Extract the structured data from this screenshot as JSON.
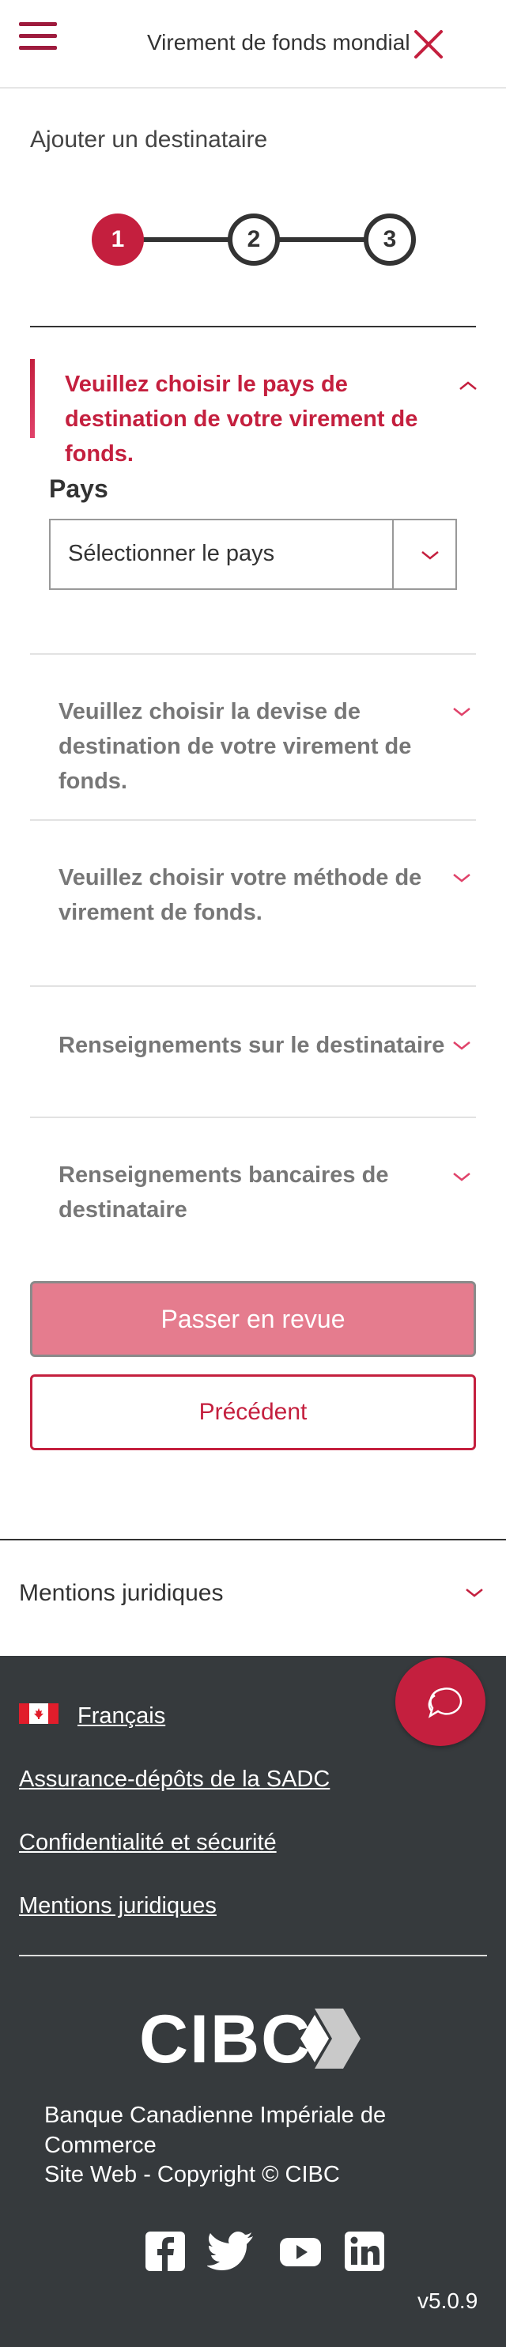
{
  "header": {
    "title": "Virement de fonds mondial"
  },
  "page": {
    "subtitle": "Ajouter un destinataire"
  },
  "stepper": {
    "steps": [
      "1",
      "2",
      "3"
    ],
    "active_step": 1
  },
  "sections": {
    "country": {
      "title": "Veuillez choisir le pays de destination de votre virement de fonds.",
      "field_label": "Pays",
      "select_value": "Sélectionner le pays"
    },
    "currency": {
      "title": "Veuillez choisir la devise de destination de votre virement de fonds."
    },
    "method": {
      "title": "Veuillez choisir votre méthode de virement de fonds."
    },
    "recipient_info": {
      "title": "Renseignements sur le destinataire"
    },
    "bank_info": {
      "title": "Renseignements bancaires de destinataire"
    }
  },
  "buttons": {
    "review": "Passer en revue",
    "previous": "Précédent"
  },
  "legal": {
    "label": "Mentions juridiques"
  },
  "footer": {
    "language": "Français",
    "links": [
      "Assurance-dépôts de la SADC",
      "Confidentialité et sécurité",
      "Mentions juridiques"
    ],
    "logo_text": "CIBC",
    "bank_name": "Banque Canadienne Impériale de Commerce",
    "copyright": "Site Web - Copyright © CIBC",
    "social": [
      "facebook-icon",
      "twitter-icon",
      "youtube-icon",
      "linkedin-icon"
    ],
    "version": "v5.0.9"
  },
  "colors": {
    "brand": "#c41f3e",
    "footer_bg": "#363a3d",
    "primary_disabled": "#e57c8e"
  }
}
